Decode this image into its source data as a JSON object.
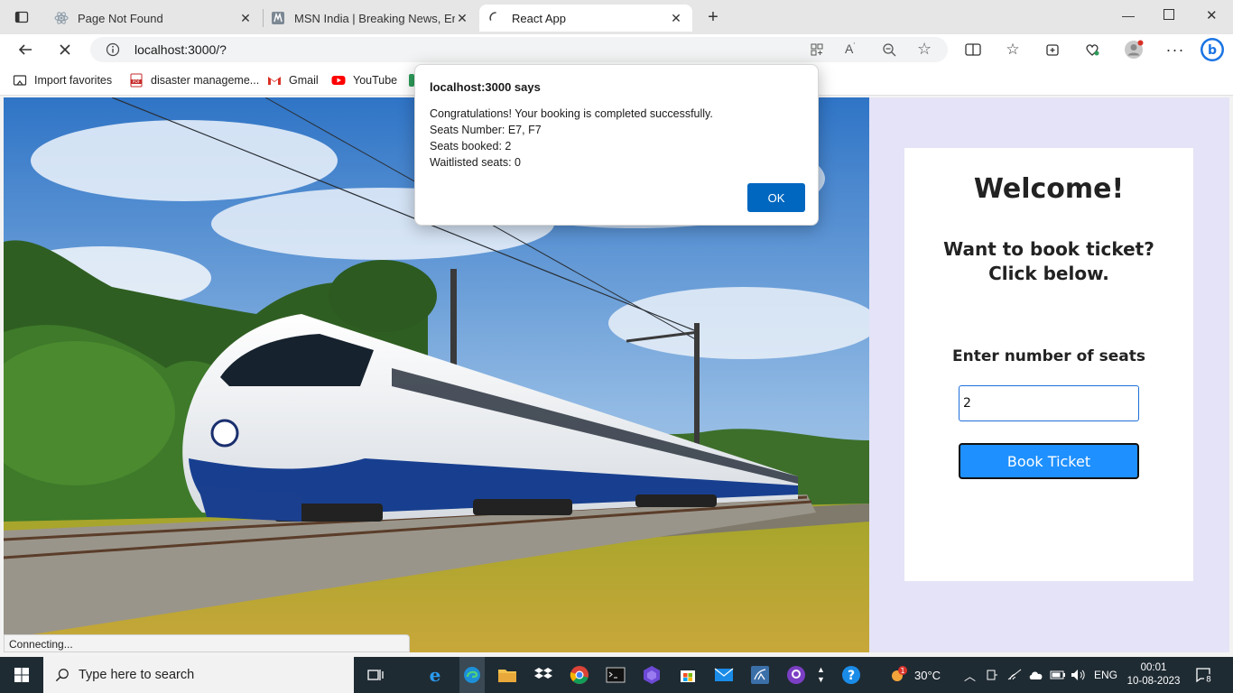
{
  "tabs": [
    {
      "title": "Page Not Found",
      "icon": "react-icon"
    },
    {
      "title": "MSN India | Breaking News, Ente",
      "icon": "msn-icon"
    },
    {
      "title": "React App",
      "icon": "loading-spinner-icon",
      "active": true
    }
  ],
  "address": {
    "url": "localhost:3000/?"
  },
  "favorites": [
    {
      "label": "Import favorites",
      "icon": "import-icon"
    },
    {
      "label": "disaster manageme...",
      "icon": "pdf-icon"
    },
    {
      "label": "Gmail",
      "icon": "gmail-icon"
    },
    {
      "label": "YouTube",
      "icon": "youtube-icon"
    }
  ],
  "dialog": {
    "title": "localhost:3000 says",
    "lines": [
      "Congratulations! Your booking is completed successfully.",
      "Seats Number: E7, F7",
      "Seats booked: 2",
      "Waitlisted seats: 0"
    ],
    "ok_label": "OK"
  },
  "card": {
    "heading": "Welcome!",
    "subheading": "Want to book ticket? Click below.",
    "seats_label": "Enter number of seats",
    "seats_value": "2",
    "button_label": "Book Ticket"
  },
  "status_text": "Connecting...",
  "taskbar": {
    "search_placeholder": "Type here to search",
    "weather": "30°C",
    "weather_badge": "1",
    "language": "ENG",
    "time": "00:01",
    "date": "10-08-2023",
    "notifications": "8"
  },
  "colors": {
    "accent": "#0067c0",
    "book_button": "#1e90ff",
    "page_background": "#e4e3f7",
    "taskbar": "#1f2b33"
  }
}
